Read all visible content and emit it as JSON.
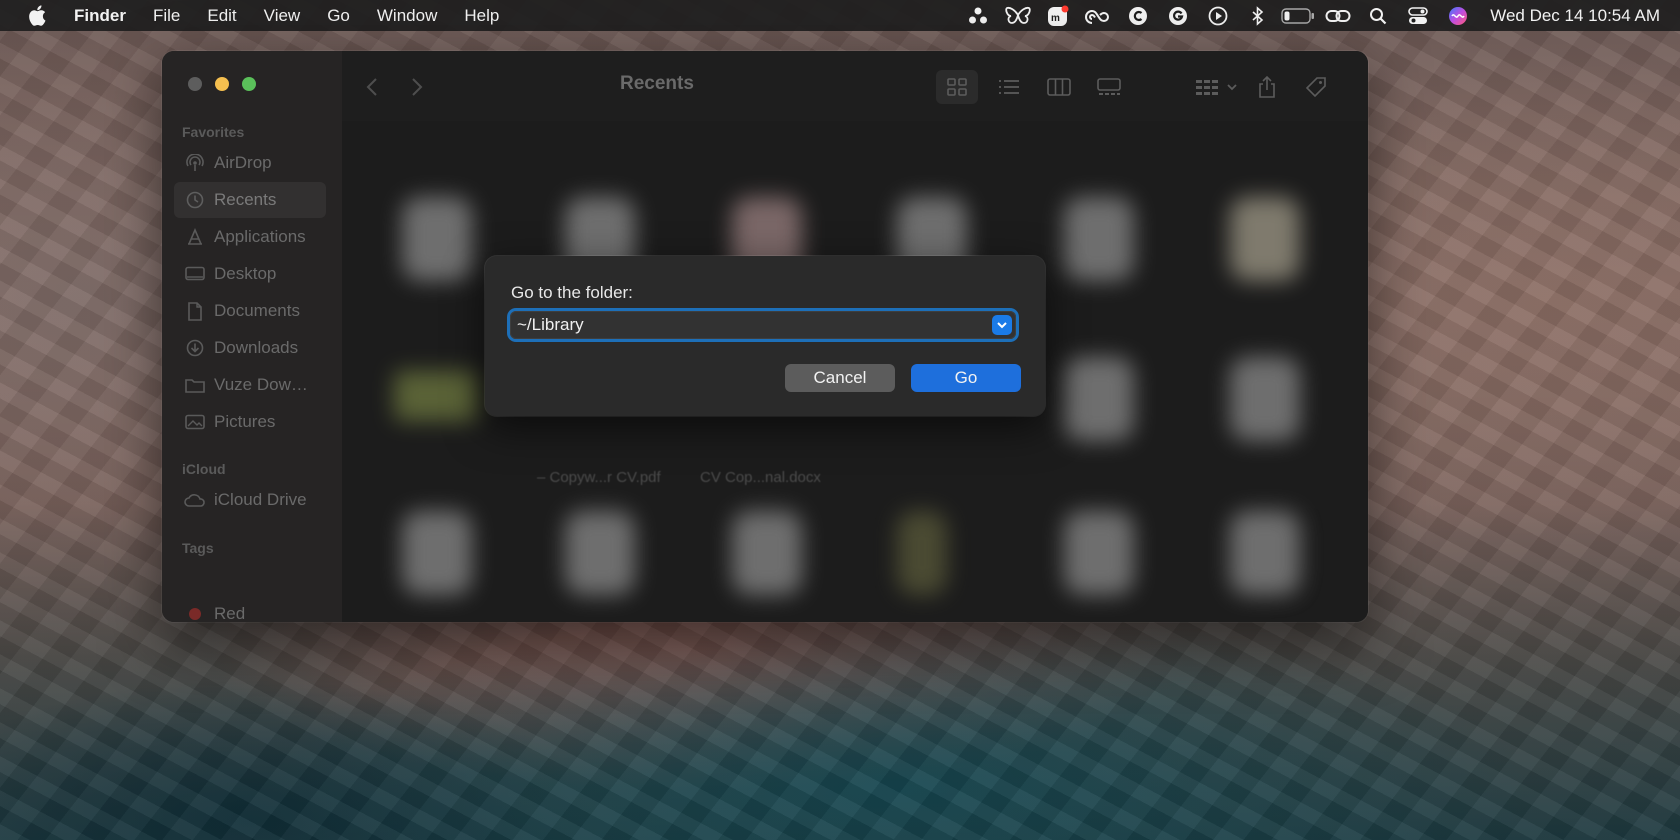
{
  "menubar": {
    "app_name": "Finder",
    "menus": [
      "File",
      "Edit",
      "View",
      "Go",
      "Window",
      "Help"
    ],
    "clock": "Wed Dec 14  10:54 AM",
    "status_icons": [
      "dots-icon",
      "butterfly-icon",
      "mm-app-icon",
      "creative-cloud-icon",
      "c-circle-icon",
      "grammarly-icon",
      "play-icon",
      "bluetooth-icon",
      "battery-icon",
      "link-icon",
      "search-icon",
      "control-center-icon",
      "siri-icon"
    ]
  },
  "finder": {
    "title": "Recents",
    "sidebar": {
      "favorites_header": "Favorites",
      "favorites": [
        {
          "label": "AirDrop",
          "icon": "airdrop-icon"
        },
        {
          "label": "Recents",
          "icon": "clock-icon",
          "selected": true
        },
        {
          "label": "Applications",
          "icon": "applications-icon"
        },
        {
          "label": "Desktop",
          "icon": "desktop-icon"
        },
        {
          "label": "Documents",
          "icon": "document-icon"
        },
        {
          "label": "Downloads",
          "icon": "downloads-icon"
        },
        {
          "label": "Vuze Downloads",
          "icon": "folder-icon"
        },
        {
          "label": "Pictures",
          "icon": "pictures-icon"
        }
      ],
      "icloud_header": "iCloud",
      "icloud": [
        {
          "label": "iCloud Drive",
          "icon": "cloud-icon"
        }
      ],
      "tags_header": "Tags",
      "tags": [
        {
          "label": "Red",
          "color": "#e0443e"
        }
      ]
    },
    "files": {
      "labels": [
        "– Copyw...r CV.pdf",
        "CV Cop...nal.docx"
      ]
    }
  },
  "dialog": {
    "label": "Go to the folder:",
    "path_value": "~/Library",
    "cancel_label": "Cancel",
    "go_label": "Go"
  },
  "colors": {
    "accent": "#1e6fdc",
    "focus_ring": "#1d6fb8"
  }
}
